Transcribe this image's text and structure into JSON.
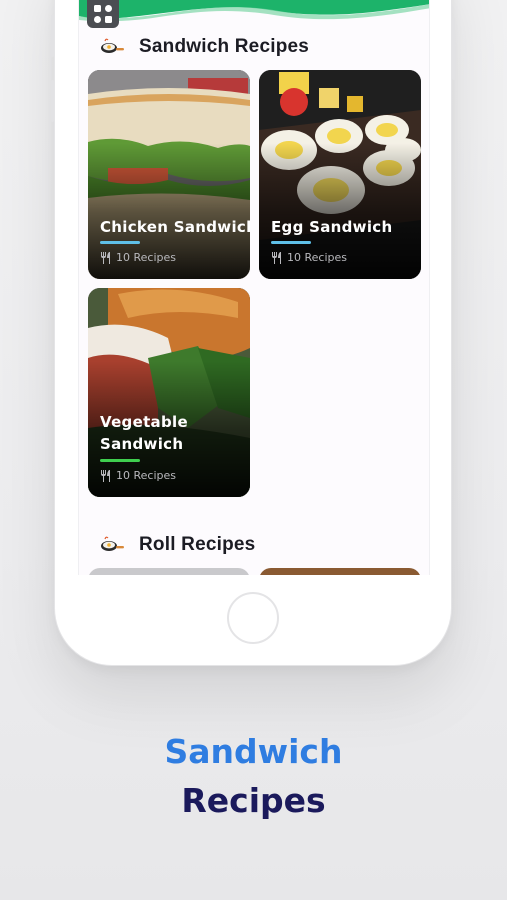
{
  "app": {
    "accent": "#1db36a",
    "menu_icon": "grid-icon"
  },
  "sections": [
    {
      "title": "Sandwich Recipes",
      "icon": "pan-icon",
      "cards": [
        {
          "title": "Chicken Sandwich",
          "meta": "10 Recipes",
          "bar_color": "#5fc0e8"
        },
        {
          "title": "Egg Sandwich",
          "meta": "10 Recipes",
          "bar_color": "#5fc0e8"
        },
        {
          "title_line1": "Vegetable",
          "title_line2": "Sandwich",
          "meta": "10 Recipes",
          "bar_color": "#3fcf4f"
        }
      ]
    },
    {
      "title": "Roll Recipes",
      "icon": "pan-icon"
    }
  ],
  "caption": {
    "line1": "Sandwich",
    "line2": "Recipes",
    "line1_color": "#2f7de1",
    "line2_color": "#1b1a5c"
  }
}
